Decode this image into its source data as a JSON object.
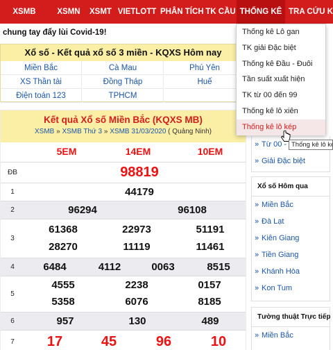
{
  "nav": {
    "items": [
      {
        "label": "XSMB"
      },
      {
        "label": "XSMN"
      },
      {
        "label": "XSMT"
      },
      {
        "label": "VIETLOTT"
      },
      {
        "label": "PHÂN TÍCH"
      },
      {
        "label": "TK CẦU"
      },
      {
        "label": "THỐNG KÊ"
      },
      {
        "label": "TRA CỨU KQ"
      }
    ]
  },
  "banner": "chung tay đẩy lùi Covid-19!",
  "regions": {
    "title": "Xổ số - Kết quả xổ số 3 miền - KQXS Hôm nay",
    "links": [
      "Miền Bắc",
      "Cà Mau",
      "Phú Yên",
      "XS Thần tài",
      "Đồng Tháp",
      "Huế",
      "Điện toán 123",
      "TPHCM",
      ""
    ]
  },
  "results": {
    "title": "Kết quả Xổ số Miền Bắc (KQXS MB)",
    "crumb": {
      "a": "XSMB",
      "sep1": " » ",
      "b": "XSMB Thứ 3",
      "sep2": " » ",
      "c": "XSMB 31/03/2020",
      "place": " ( Quảng Ninh)"
    },
    "codes": [
      "5EM",
      "14EM",
      "10EM"
    ],
    "rows": [
      {
        "label": "ĐB",
        "nums": [
          "98819"
        ]
      },
      {
        "label": "1",
        "nums": [
          "44179"
        ]
      },
      {
        "label": "2",
        "nums": [
          "96294",
          "96108"
        ]
      },
      {
        "label": "3",
        "nums": [
          "61368",
          "22973",
          "51191",
          "28270",
          "11119",
          "11461"
        ]
      },
      {
        "label": "4",
        "nums": [
          "6484",
          "4112",
          "0063",
          "8515"
        ]
      },
      {
        "label": "5",
        "nums": [
          "4555",
          "2238",
          "0157",
          "5358",
          "6076",
          "8185"
        ]
      },
      {
        "label": "6",
        "nums": [
          "957",
          "130",
          "489"
        ]
      },
      {
        "label": "7",
        "nums": [
          "17",
          "45",
          "96",
          "10"
        ]
      }
    ]
  },
  "sidebar": {
    "top_items": [
      "Từ 00 - 9",
      "Giải Đặc biệt"
    ],
    "yesterday": {
      "title": "Xổ số Hôm qua",
      "items": [
        "Miền Bắc",
        "Đà Lạt",
        "Kiên Giang",
        "Tiền Giang",
        "Khánh Hòa",
        "Kon Tum"
      ]
    },
    "live": {
      "title": "Tường thuật Trực tiếp",
      "items": [
        "Miền Bắc"
      ]
    }
  },
  "dropdown": {
    "items": [
      "Thống kê Lô gan",
      "TK giải Đặc biệt",
      "Thống kê Đầu - Đuôi",
      "Tần suất xuất hiện",
      "TK từ 00 đến 99",
      "Thống kê lô xiên",
      "Thống kê lô kép"
    ]
  },
  "tooltip": "Thống kê lô kép",
  "colors": {
    "nav": "#d31c1c",
    "panel": "#fbefa6",
    "link": "#1a55a8",
    "result_red": "#e11111"
  }
}
